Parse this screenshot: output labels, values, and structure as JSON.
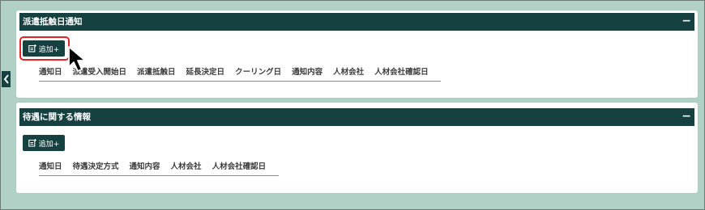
{
  "panels": [
    {
      "title": "派遣抵触日通知",
      "collapse_symbol": "−",
      "add_label": "追加+",
      "columns": [
        "通知日",
        "派遣受入開始日",
        "派遣抵触日",
        "延長決定日",
        "クーリング日",
        "通知内容",
        "人材会社",
        "人材会社確認日"
      ]
    },
    {
      "title": "待遇に関する情報",
      "collapse_symbol": "−",
      "add_label": "追加+",
      "columns": [
        "通知日",
        "待遇決定方式",
        "通知内容",
        "人材会社",
        "人材会社確認日"
      ]
    }
  ],
  "colors": {
    "header_bg": "#154140",
    "page_bg": "#b1d0c6",
    "highlight": "#e0242a"
  },
  "icons": {
    "add": "edit-add-icon",
    "side": "chevron-left-icon",
    "cursor": "mouse-pointer-icon"
  }
}
